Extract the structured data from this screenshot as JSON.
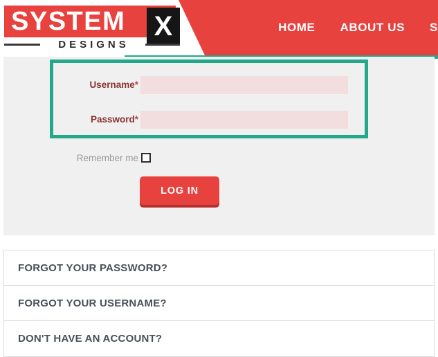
{
  "header": {
    "logo": {
      "word_main": "SYSTEM",
      "word_x": "X",
      "word_sub": "DESIGNS"
    },
    "nav": [
      {
        "label": "HOME"
      },
      {
        "label": "ABOUT US"
      },
      {
        "label": "S"
      }
    ],
    "brand_color": "#e8423f",
    "accent_color": "#23a88b"
  },
  "login_form": {
    "username": {
      "label": "Username",
      "required_mark": "*",
      "value": "",
      "placeholder": ""
    },
    "password": {
      "label": "Password",
      "required_mark": "*",
      "value": "",
      "placeholder": ""
    },
    "remember_me": {
      "label": "Remember me",
      "checked": false
    },
    "submit_label": "LOG IN",
    "field_bg_color": "#f2dede",
    "label_color": "#8a3230",
    "highlight_border_color": "#23a88b"
  },
  "accordion": {
    "items": [
      {
        "title": "FORGOT YOUR PASSWORD?"
      },
      {
        "title": "FORGOT YOUR USERNAME?"
      },
      {
        "title": "DON'T HAVE AN ACCOUNT?"
      }
    ]
  }
}
